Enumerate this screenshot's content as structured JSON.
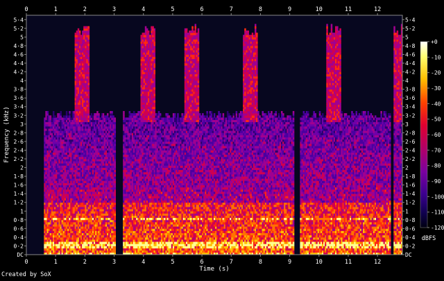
{
  "chart_data": {
    "type": "heatmap",
    "title": "",
    "xlabel": "Time (s)",
    "ylabel": "Frequency (kHz)",
    "xlim": [
      0,
      12.85
    ],
    "ylim": [
      0,
      5.5
    ],
    "x_ticks": [
      "0",
      "1",
      "2",
      "3",
      "4",
      "5",
      "6",
      "7",
      "8",
      "9",
      "10",
      "11",
      "12"
    ],
    "y_ticks": [
      "DC",
      "0·2",
      "0·4",
      "0·6",
      "0·8",
      "1",
      "1·2",
      "1·4",
      "1·6",
      "1·8",
      "2",
      "2·2",
      "2·4",
      "2·6",
      "2·8",
      "3",
      "3·2",
      "3·4",
      "3·6",
      "3·8",
      "4",
      "4·2",
      "4·4",
      "4·6",
      "4·8",
      "5",
      "5·2",
      "5·4"
    ],
    "colorbar": {
      "unit": "dBFS",
      "ticks": [
        "+0",
        "-10",
        "-20",
        "-30",
        "-40",
        "-50",
        "-60",
        "-70",
        "-80",
        "-90",
        "-100",
        "-110",
        "-120"
      ],
      "range": [
        -120,
        0
      ]
    },
    "grid": false,
    "credit": "Created by SoX"
  },
  "colors": {
    "background": "#000000",
    "plot_background": "#07071f",
    "axis": "#8a8a8a",
    "text": "#ffffff"
  }
}
